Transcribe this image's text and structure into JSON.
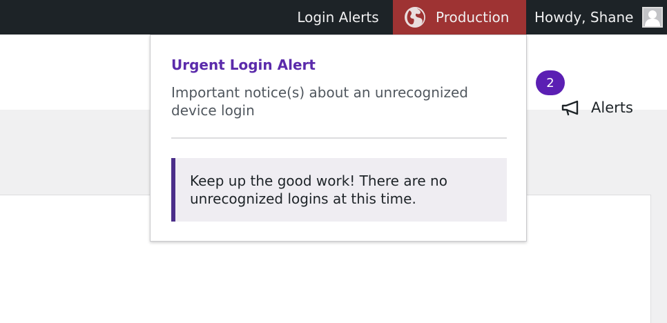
{
  "adminbar": {
    "login_alerts_label": "Login Alerts",
    "environment_label": "Production",
    "howdy_label": "Howdy, Shane",
    "environment_color": "#9e3333",
    "icons": {
      "environment": "globe-icon",
      "user": "avatar-icon"
    }
  },
  "header": {
    "alerts_badge_count": "2",
    "alerts_label": "Alerts",
    "alerts_icon": "megaphone-icon",
    "badge_color": "#5b1fb3"
  },
  "dropdown": {
    "title": "Urgent Login Alert",
    "description": "Important notice(s) about an unrecognized device login",
    "notice": "Keep up the good work! There are no unrecognized logins at this time.",
    "title_color": "#5b2bab",
    "notice_accent_color": "#4b2e8a"
  }
}
